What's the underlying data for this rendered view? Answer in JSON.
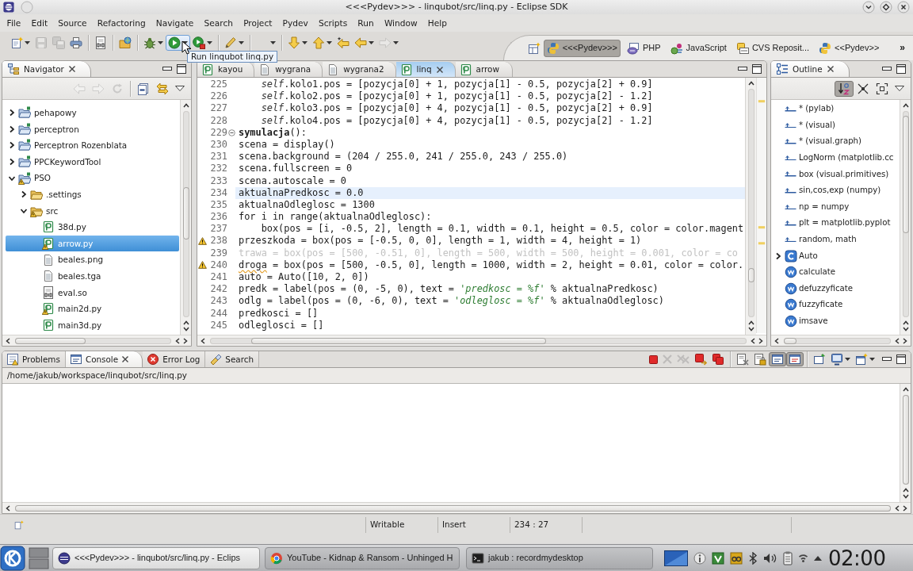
{
  "window": {
    "title": "<<<Pydev>>> - linqubot/src/linq.py - Eclipse SDK"
  },
  "menu": [
    "File",
    "Edit",
    "Source",
    "Refactoring",
    "Navigate",
    "Search",
    "Project",
    "Pydev",
    "Scripts",
    "Run",
    "Window",
    "Help"
  ],
  "toolbar": [
    {
      "kind": "new",
      "dropdown": true,
      "disabled": false,
      "highlighted": false
    },
    {
      "kind": "save",
      "dropdown": false,
      "disabled": true,
      "highlighted": false
    },
    {
      "kind": "save-all",
      "dropdown": false,
      "disabled": true,
      "highlighted": false
    },
    {
      "kind": "print",
      "dropdown": false,
      "disabled": false,
      "highlighted": false
    },
    {
      "kind": "separator"
    },
    {
      "kind": "binary",
      "dropdown": false,
      "disabled": false,
      "highlighted": false
    },
    {
      "kind": "separator"
    },
    {
      "kind": "open-folder",
      "dropdown": false,
      "disabled": false,
      "highlighted": false
    },
    {
      "kind": "separator"
    },
    {
      "kind": "debug",
      "dropdown": true,
      "disabled": false,
      "highlighted": false
    },
    {
      "kind": "run",
      "dropdown": true,
      "disabled": false,
      "highlighted": true
    },
    {
      "kind": "run-external",
      "dropdown": true,
      "disabled": false,
      "highlighted": false
    },
    {
      "kind": "separator"
    },
    {
      "kind": "brush",
      "dropdown": true,
      "disabled": false,
      "highlighted": false
    },
    {
      "kind": "separator"
    },
    {
      "kind": "empty",
      "dropdown": true,
      "disabled": false,
      "highlighted": false
    },
    {
      "kind": "separator"
    },
    {
      "kind": "next-annotation",
      "dropdown": true,
      "disabled": false,
      "highlighted": false
    },
    {
      "kind": "prev-annotation",
      "dropdown": true,
      "disabled": false,
      "highlighted": false
    },
    {
      "kind": "last-edit",
      "dropdown": false,
      "disabled": false,
      "highlighted": false
    },
    {
      "kind": "back",
      "dropdown": true,
      "disabled": false,
      "highlighted": false
    },
    {
      "kind": "forward",
      "dropdown": true,
      "disabled": true,
      "highlighted": false
    }
  ],
  "tooltip": {
    "text": "Run linqubot linq.py"
  },
  "perspectives": [
    {
      "label": "<<<Pydev>>>",
      "kind": "python",
      "selected": true
    },
    {
      "label": "PHP",
      "kind": "php",
      "selected": false
    },
    {
      "label": "JavaScript",
      "kind": "javascript",
      "selected": false
    },
    {
      "label": "CVS Reposit...",
      "kind": "cvs",
      "selected": false
    },
    {
      "label": "<<Pydev>>",
      "kind": "python",
      "selected": false
    }
  ],
  "perspective_overflow": "»",
  "navigator": {
    "title": "Navigator",
    "toolbar": [
      {
        "kind": "back",
        "disabled": true
      },
      {
        "kind": "forward",
        "disabled": true
      },
      {
        "kind": "refresh",
        "disabled": true
      },
      {
        "kind": "separator"
      },
      {
        "kind": "collapse-all",
        "disabled": false
      },
      {
        "kind": "link",
        "disabled": false
      },
      {
        "kind": "view-menu",
        "disabled": false
      }
    ],
    "items": [
      {
        "label": "pehapowy",
        "kind": "project",
        "expanded": false,
        "selected": false,
        "warning": false
      },
      {
        "label": "perceptron",
        "kind": "project",
        "expanded": false,
        "selected": false,
        "warning": false
      },
      {
        "label": "Perceptron Rozenblata",
        "kind": "project",
        "expanded": false,
        "selected": false,
        "warning": false
      },
      {
        "label": "PPCKeywordTool",
        "kind": "project",
        "expanded": false,
        "selected": false,
        "warning": false
      },
      {
        "label": "PSO",
        "kind": "project",
        "expanded": true,
        "selected": false,
        "warning": true,
        "children": [
          {
            "label": ".settings",
            "kind": "folder",
            "expanded": false,
            "selected": false,
            "warning": false
          },
          {
            "label": "src",
            "kind": "folder",
            "expanded": true,
            "selected": false,
            "warning": true,
            "children": [
              {
                "label": "38d.py",
                "kind": "python",
                "selected": false,
                "warning": false
              },
              {
                "label": "arrow.py",
                "kind": "python",
                "selected": true,
                "warning": true
              },
              {
                "label": "beales.png",
                "kind": "file",
                "selected": false,
                "warning": false
              },
              {
                "label": "beales.tga",
                "kind": "file",
                "selected": false,
                "warning": false
              },
              {
                "label": "eval.so",
                "kind": "binary",
                "selected": false,
                "warning": false
              },
              {
                "label": "main2d.py",
                "kind": "python",
                "selected": false,
                "warning": true
              },
              {
                "label": "main3d.py",
                "kind": "python",
                "selected": false,
                "warning": false
              }
            ]
          }
        ]
      }
    ]
  },
  "editor": {
    "tabs": [
      {
        "label": "kayou",
        "kind": "python",
        "selected": false
      },
      {
        "label": "wygrana",
        "kind": "file",
        "selected": false
      },
      {
        "label": "wygrana2",
        "kind": "file",
        "selected": false
      },
      {
        "label": "linq",
        "kind": "python",
        "selected": true
      },
      {
        "label": "arrow",
        "kind": "python",
        "selected": false
      }
    ],
    "lines": [
      {
        "number": "225",
        "kind": "code",
        "current": false,
        "parts": [
          {
            "kind": "self",
            "text": "    self"
          },
          {
            "kind": "plain",
            "text": ".kolo1.pos = [pozycja[0] + 1, pozycja[1] - 0.5, pozycja[2] + 0.9]"
          }
        ]
      },
      {
        "number": "226",
        "kind": "code",
        "current": false,
        "parts": [
          {
            "kind": "self",
            "text": "    self"
          },
          {
            "kind": "plain",
            "text": ".kolo2.pos = [pozycja[0] + 1, pozycja[1] - 0.5, pozycja[2] - 1.2]"
          }
        ]
      },
      {
        "number": "227",
        "kind": "code",
        "current": false,
        "parts": [
          {
            "kind": "self",
            "text": "    self"
          },
          {
            "kind": "plain",
            "text": ".kolo3.pos = [pozycja[0] + 4, pozycja[1] - 0.5, pozycja[2] + 0.9]"
          }
        ]
      },
      {
        "number": "228",
        "kind": "code",
        "current": false,
        "parts": [
          {
            "kind": "self",
            "text": "    self"
          },
          {
            "kind": "plain",
            "text": ".kolo4.pos = [pozycja[0] + 4, pozycja[1] - 0.5, pozycja[2] - 1.2]"
          }
        ]
      },
      {
        "number": "229",
        "kind": "fold",
        "current": false,
        "parts": [
          {
            "kind": "bold",
            "text": "symulacja"
          },
          {
            "kind": "plain",
            "text": "():"
          }
        ]
      },
      {
        "number": "230",
        "kind": "code",
        "current": false,
        "parts": [
          {
            "kind": "plain",
            "text": "scena = display()"
          }
        ]
      },
      {
        "number": "231",
        "kind": "code",
        "current": false,
        "parts": [
          {
            "kind": "plain",
            "text": "scena.background = (204 / 255.0, 241 / 255.0, 243 / 255.0)"
          }
        ]
      },
      {
        "number": "232",
        "kind": "code",
        "current": false,
        "parts": [
          {
            "kind": "plain",
            "text": "scena.fullscreen = 0"
          }
        ]
      },
      {
        "number": "233",
        "kind": "code",
        "current": false,
        "parts": [
          {
            "kind": "plain",
            "text": "scena.autoscale = 0"
          }
        ]
      },
      {
        "number": "234",
        "kind": "code",
        "current": true,
        "parts": [
          {
            "kind": "plain",
            "text": "aktualnaPredkosc = 0.0"
          }
        ]
      },
      {
        "number": "235",
        "kind": "code",
        "current": false,
        "parts": [
          {
            "kind": "plain",
            "text": "aktualnaOdleglosc = 1300"
          }
        ]
      },
      {
        "number": "236",
        "kind": "code",
        "current": false,
        "parts": [
          {
            "kind": "plain",
            "text": "for i in range(aktualnaOdleglosc):"
          }
        ]
      },
      {
        "number": "237",
        "kind": "code",
        "current": false,
        "parts": [
          {
            "kind": "plain",
            "text": "    box(pos = [i, -0.5, 2], length = 0.1, width = 0.1, height = 0.5, color = color.magent"
          }
        ]
      },
      {
        "number": "238",
        "kind": "warning",
        "current": false,
        "parts": [
          {
            "kind": "plain",
            "text": "przeszkoda = box(pos = [-0.5, 0, 0], length = 1, width = 4, height = 1)"
          }
        ]
      },
      {
        "number": "239",
        "kind": "code",
        "current": false,
        "parts": [
          {
            "kind": "faded",
            "text": "trawa = box(pos = [500, -0.51, 0], length = 500, width = 500, height = 0.001, color = co"
          }
        ]
      },
      {
        "number": "240",
        "kind": "warning",
        "current": false,
        "parts": [
          {
            "kind": "squiggle",
            "text": "droga"
          },
          {
            "kind": "plain",
            "text": " = box(pos = [500, -0.5, 0], length = 1000, width = 2, height = 0.01, color = color."
          }
        ]
      },
      {
        "number": "241",
        "kind": "code",
        "current": false,
        "parts": [
          {
            "kind": "plain",
            "text": "auto = Auto([10, 2, 0])"
          }
        ]
      },
      {
        "number": "242",
        "kind": "code",
        "current": false,
        "parts": [
          {
            "kind": "plain",
            "text": "predk = label(pos = (0, -5, 0), text = "
          },
          {
            "kind": "string",
            "text": "'predkosc = %f'"
          },
          {
            "kind": "plain",
            "text": " % aktualnaPredkosc)"
          }
        ]
      },
      {
        "number": "243",
        "kind": "code",
        "current": false,
        "parts": [
          {
            "kind": "plain",
            "text": "odlg = label(pos = (0, -6, 0), text = "
          },
          {
            "kind": "string",
            "text": "'odleglosc = %f'"
          },
          {
            "kind": "plain",
            "text": " % aktualnaOdleglosc)"
          }
        ]
      },
      {
        "number": "244",
        "kind": "code",
        "current": false,
        "parts": [
          {
            "kind": "plain",
            "text": "predkosci = []"
          }
        ]
      },
      {
        "number": "245",
        "kind": "code",
        "current": false,
        "parts": [
          {
            "kind": "plain",
            "text": "odleglosci = []"
          }
        ]
      }
    ]
  },
  "outline": {
    "title": "Outline",
    "toolbar": [
      {
        "kind": "sort",
        "pressed": true
      },
      {
        "kind": "hide-fields",
        "pressed": false
      },
      {
        "kind": "hide-static",
        "pressed": false
      },
      {
        "kind": "view-menu",
        "pressed": false
      }
    ],
    "items": [
      {
        "label": "* (pylab)",
        "kind": "import",
        "selected": false
      },
      {
        "label": "* (visual)",
        "kind": "import",
        "selected": false
      },
      {
        "label": "* (visual.graph)",
        "kind": "import",
        "selected": false
      },
      {
        "label": "LogNorm (matplotlib.cc",
        "kind": "import",
        "selected": false
      },
      {
        "label": "box (visual.primitives)",
        "kind": "import",
        "selected": false
      },
      {
        "label": "sin,cos,exp (numpy)",
        "kind": "import",
        "selected": false
      },
      {
        "label": "np = numpy",
        "kind": "import",
        "selected": false
      },
      {
        "label": "plt = matplotlib.pyplot",
        "kind": "import",
        "selected": false
      },
      {
        "label": "random, math",
        "kind": "import",
        "selected": false
      },
      {
        "label": "Auto",
        "kind": "class",
        "expanded": false,
        "selected": false
      },
      {
        "label": "calculate",
        "kind": "function",
        "selected": false
      },
      {
        "label": "defuzzyficate",
        "kind": "function",
        "selected": false
      },
      {
        "label": "fuzzyficate",
        "kind": "function",
        "selected": false
      },
      {
        "label": "imsave",
        "kind": "function",
        "selected": false
      }
    ]
  },
  "console_panel": {
    "tabs": [
      {
        "label": "Problems",
        "kind": "problems",
        "selected": false
      },
      {
        "label": "Console",
        "kind": "console",
        "selected": true
      },
      {
        "label": "Error Log",
        "kind": "errorlog",
        "selected": false
      },
      {
        "label": "Search",
        "kind": "search",
        "selected": false
      }
    ],
    "toolbar": [
      {
        "kind": "terminate",
        "disabled": false,
        "pressed": false,
        "dropdown": false
      },
      {
        "kind": "remove",
        "disabled": true,
        "pressed": false,
        "dropdown": false
      },
      {
        "kind": "remove-all",
        "disabled": true,
        "pressed": false,
        "dropdown": false
      },
      {
        "kind": "terminate-relaunch",
        "disabled": false,
        "pressed": false,
        "dropdown": false
      },
      {
        "kind": "terminate-all",
        "disabled": false,
        "pressed": false,
        "dropdown": false
      },
      {
        "kind": "separator"
      },
      {
        "kind": "clear",
        "disabled": false,
        "pressed": false,
        "dropdown": false
      },
      {
        "kind": "scroll-lock",
        "disabled": false,
        "pressed": false,
        "dropdown": false
      },
      {
        "kind": "show-stdout",
        "disabled": false,
        "pressed": true,
        "dropdown": false
      },
      {
        "kind": "show-stderr",
        "disabled": false,
        "pressed": true,
        "dropdown": false
      },
      {
        "kind": "separator"
      },
      {
        "kind": "pin",
        "disabled": false,
        "pressed": false,
        "dropdown": false
      },
      {
        "kind": "display",
        "disabled": false,
        "pressed": false,
        "dropdown": true
      },
      {
        "kind": "open-console",
        "disabled": false,
        "pressed": false,
        "dropdown": true
      }
    ],
    "path": "/home/jakub/workspace/linqubot/src/linq.py"
  },
  "status_bar": {
    "fields": [
      "Writable",
      "Insert",
      "234 : 27"
    ]
  },
  "taskbar": {
    "tasks": [
      {
        "label": "<<<Pydev>>> - linqubot/src/linq.py - Eclips",
        "kind": "eclipse",
        "selected": true
      },
      {
        "label": "YouTube - Kidnap & Ransom - Unhinged H",
        "kind": "browser",
        "selected": false
      },
      {
        "label": "jakub : recordmydesktop",
        "kind": "terminal",
        "selected": false
      }
    ],
    "clock": "02:00"
  }
}
